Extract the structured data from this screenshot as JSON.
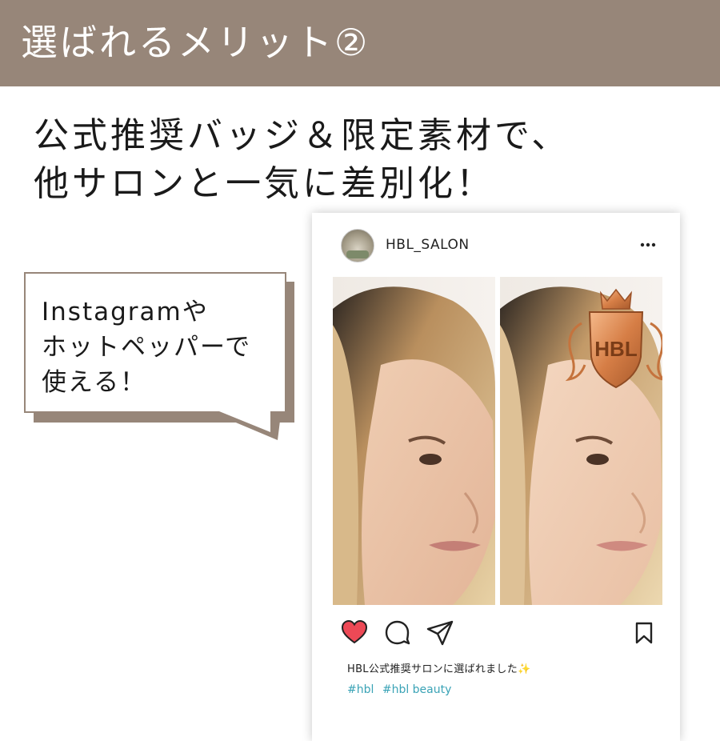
{
  "banner": {
    "title": "選ばれるメリット②",
    "color": "#978679"
  },
  "headline": {
    "line1": "公式推奨バッジ＆限定素材で、",
    "line2": "他サロンと一気に差別化！"
  },
  "bubble": {
    "line1": "Instagramや",
    "line2": "ホットペッパーで",
    "line3": "使える！"
  },
  "post": {
    "account_name": "HBL_SALON",
    "badge_text": "HBL",
    "caption": "HBL公式推奨サロンに選ばれました",
    "caption_emoji": "✨",
    "tags": [
      "#hbl",
      "#hbl beauty"
    ],
    "icons": [
      "more-icon",
      "heart-icon",
      "comment-icon",
      "share-icon",
      "bookmark-icon"
    ],
    "like_color": "#ed4956",
    "tag_color": "#3aa3b6"
  }
}
